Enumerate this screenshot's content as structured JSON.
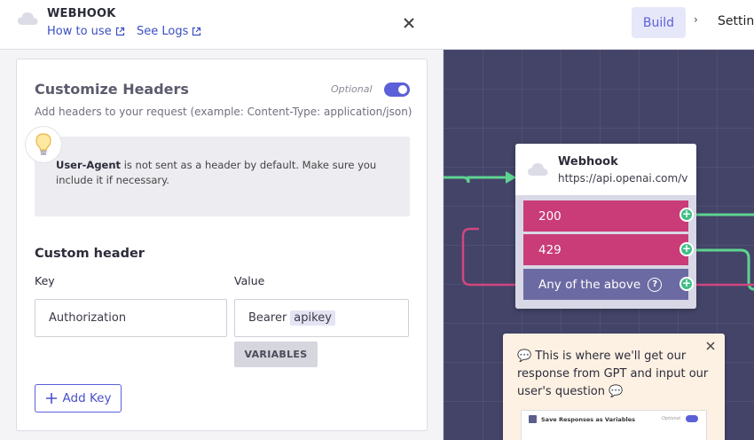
{
  "panel": {
    "title": "WEBHOOK",
    "how_to_use": "How to use",
    "see_logs": "See Logs"
  },
  "headers": {
    "title": "Customize Headers",
    "optional": "Optional",
    "toggle_on": true,
    "description": "Add headers to your request (example: Content-Type: application/json)",
    "tip_bold": "User-Agent",
    "tip_rest": " is not sent as a header by default. Make sure you include it if necessary."
  },
  "custom_header": {
    "title": "Custom header",
    "key_label": "Key",
    "value_label": "Value",
    "key_value": "Authorization",
    "value_prefix": "Bearer",
    "value_variable": "apikey",
    "variables_button": "VARIABLES",
    "add_key_button": "Add Key"
  },
  "topbar": {
    "build_tab": "Build",
    "separator": "›",
    "settings_tab": "Setting"
  },
  "node": {
    "title": "Webhook",
    "url": "https://api.openai.com/v",
    "ports": [
      {
        "label": "200"
      },
      {
        "label": "429"
      },
      {
        "label": "Any of the above"
      }
    ],
    "help_glyph": "?"
  },
  "tooltip": {
    "text": "💬 This is where we'll get our response from GPT and input our user's question 💬",
    "preview_title": "Save Responses as Variables",
    "preview_optional": "Optional"
  },
  "colors": {
    "accent": "#5b60d8",
    "port_status": "#c93c77",
    "port_any": "#6c6aa3",
    "connector": "#3fbf86",
    "canvas": "#434468"
  }
}
